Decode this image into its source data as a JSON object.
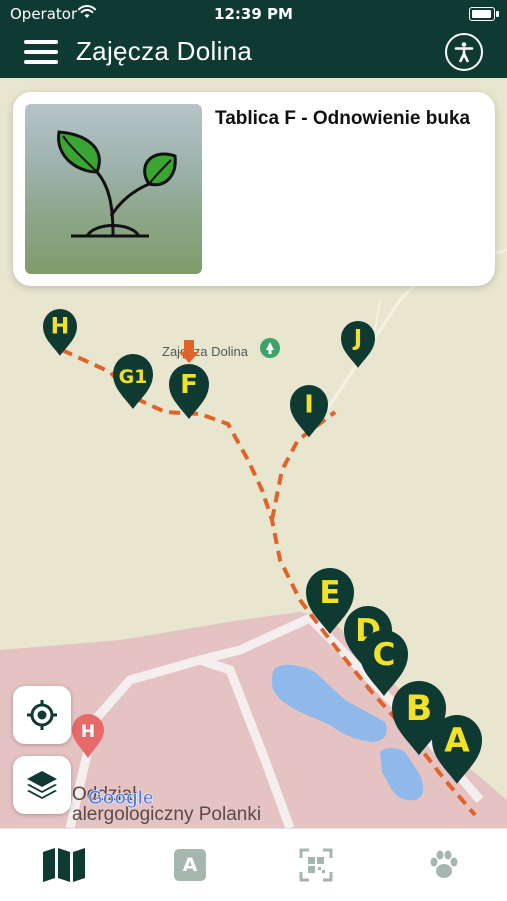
{
  "status_bar": {
    "carrier": "Operator",
    "time": "12:39 PM"
  },
  "header": {
    "title": "Zajęcza Dolina",
    "menu_icon": "hamburger-menu-icon",
    "accessibility_icon": "accessibility-icon"
  },
  "info_card": {
    "title": "Tablica F - Odnowienie buka",
    "image_icon": "sprout-icon"
  },
  "map": {
    "place_label": "Zajęcza Dolina",
    "poi_label": "Oddział alergologiczny Polanki",
    "poi_label_line1": "Oddział",
    "poi_label_line2": "alergologiczny Polanki",
    "hospital_symbol": "H",
    "provider": "Google",
    "markers": [
      "H",
      "G1",
      "F",
      "J",
      "I",
      "E",
      "D",
      "C",
      "B",
      "A"
    ],
    "selected_marker": "F",
    "route_color": "#e0642a",
    "marker_color": "#0f3a32",
    "marker_text_color": "#f2e12a"
  },
  "controls": {
    "locate_icon": "crosshair-icon",
    "layers_icon": "layers-icon"
  },
  "tabs": [
    {
      "name": "map",
      "icon": "map-icon",
      "active": true
    },
    {
      "name": "a",
      "icon": "letter-a-icon",
      "label": "A",
      "active": false
    },
    {
      "name": "qr",
      "icon": "qr-scan-icon",
      "active": false
    },
    {
      "name": "animals",
      "icon": "paw-icon",
      "active": false
    }
  ],
  "colors": {
    "accent": "#0f3a32",
    "route": "#e0642a",
    "marker_letter": "#f2e12a",
    "map_bg": "#e8e6cf",
    "area_pink": "#e6c3c3",
    "water": "#8fb9ea"
  }
}
